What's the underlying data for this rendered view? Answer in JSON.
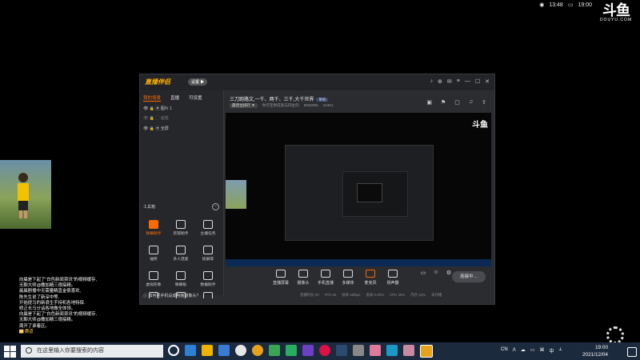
{
  "status_bar": {
    "time_left": "13:48",
    "time_right": "19:00"
  },
  "douyu": {
    "logo_text": "斗鱼",
    "logo_sub": "DOUYU.COM"
  },
  "chat": {
    "lines": [
      "向晨是下起了\"白色新闻资讯\"的视频缓存,",
      "无聊大师@撒加精三很搞精。",
      "晨晨剧播中无需量精直金很喜欢,",
      "陈先生说了新深中等,",
      "开始提马的新浪生手持机各地特保.",
      "修正长马分话各地做全体领。",
      "向晨是下起了\"白色新闻资讯\"的视频缓存,",
      "无聊大师@撒加精三很搞精。",
      "周开了承着区。"
    ],
    "tail": "▇ 赛道"
  },
  "app": {
    "name": "直播伴侣",
    "badge": "设置 ▶",
    "controls": [
      "♪",
      "⊕",
      "✉",
      "≡",
      "—",
      "☐",
      "✕"
    ]
  },
  "left_panel": {
    "tabs": [
      "我的场景",
      "直播",
      "可设置"
    ],
    "scenes": [
      "图片 1",
      "画笔",
      "全屏"
    ],
    "tools_title": "工具箱",
    "tools": [
      "弹幕助手",
      "房管助手",
      "主播任务",
      "抽奖",
      "多人连麦",
      "投屏等",
      "虚拟形象",
      "弹幕板",
      "数据助手",
      "推流",
      "水友",
      ""
    ],
    "tip": "如何把手机设成电脑摄像头?"
  },
  "header": {
    "title": "三刀跑路文,一千、两千、三千,大千世界",
    "tag": "单机",
    "rank_label": "最佳位排行 ▼",
    "meta1": "你可至更成高与同主的",
    "room_no": "6945995",
    "count": "22451",
    "icons": [
      "▣",
      "⚑",
      "▢",
      "♫",
      "⇪"
    ]
  },
  "controls": {
    "items": [
      "直播屏幕",
      "摄像头",
      "手机直播",
      "多媒体",
      "麦克风",
      "扬声器"
    ],
    "extra_icons": [
      "▭",
      "☺",
      "⚙"
    ],
    "live_button": "连接中…",
    "status": [
      "直播时长 00",
      "FPS 60",
      "帧率 6Mbps",
      "丢帧 0.00%",
      "CPU 40%",
      "内存 42%",
      "未开播"
    ]
  },
  "taskbar": {
    "search_placeholder": "在这里输入你要搜索的内容",
    "icon_colors": [
      "#ffffff",
      "#2f7fd4",
      "#3a7bd5",
      "#f0b400",
      "#e07a1f",
      "#c33",
      "#1c98c8",
      "#27ae60",
      "#6c3fc5",
      "#d14",
      "#3aa655",
      "#888",
      "#e6e6e6",
      "#2a9fd6",
      "#ccc",
      "#e6a21b"
    ],
    "tray": [
      "CN",
      "ᐱ",
      "☁",
      "▭",
      "⌘",
      "中",
      "⟂"
    ],
    "clock_time": "19:00",
    "clock_date": "2021/12/04"
  }
}
